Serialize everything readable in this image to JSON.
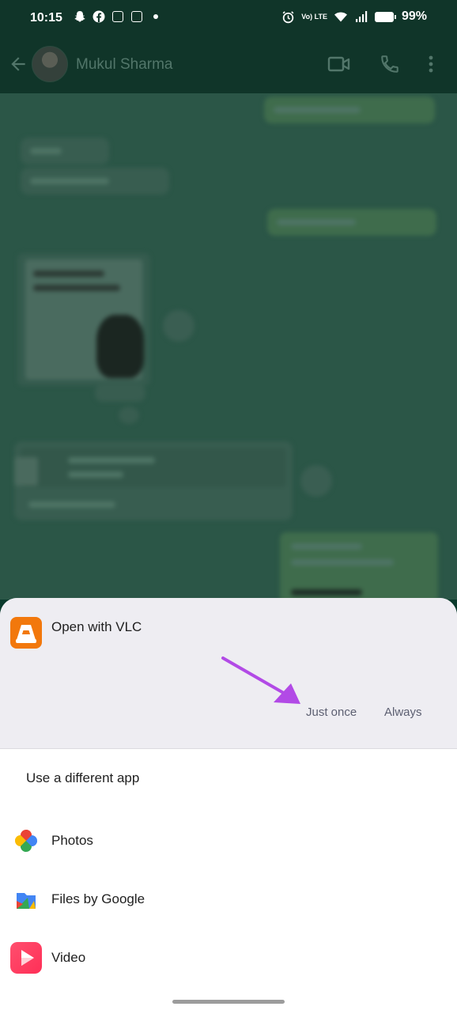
{
  "status_bar": {
    "time": "10:15",
    "battery": "99%",
    "network_label": "Vo) LTE"
  },
  "chat_header": {
    "contact_name": "Mukul Sharma"
  },
  "bottom_sheet": {
    "title": "Open with VLC",
    "just_once_label": "Just once",
    "always_label": "Always",
    "other_apps_header": "Use a different app",
    "apps": [
      {
        "name": "Photos",
        "icon": "google-photos-icon"
      },
      {
        "name": "Files by Google",
        "icon": "files-by-google-icon"
      },
      {
        "name": "Video",
        "icon": "video-player-icon"
      }
    ]
  },
  "colors": {
    "annotation_arrow": "#b24ae6",
    "vlc_orange": "#f2780c",
    "sheet_top_bg": "#eeedf2"
  }
}
